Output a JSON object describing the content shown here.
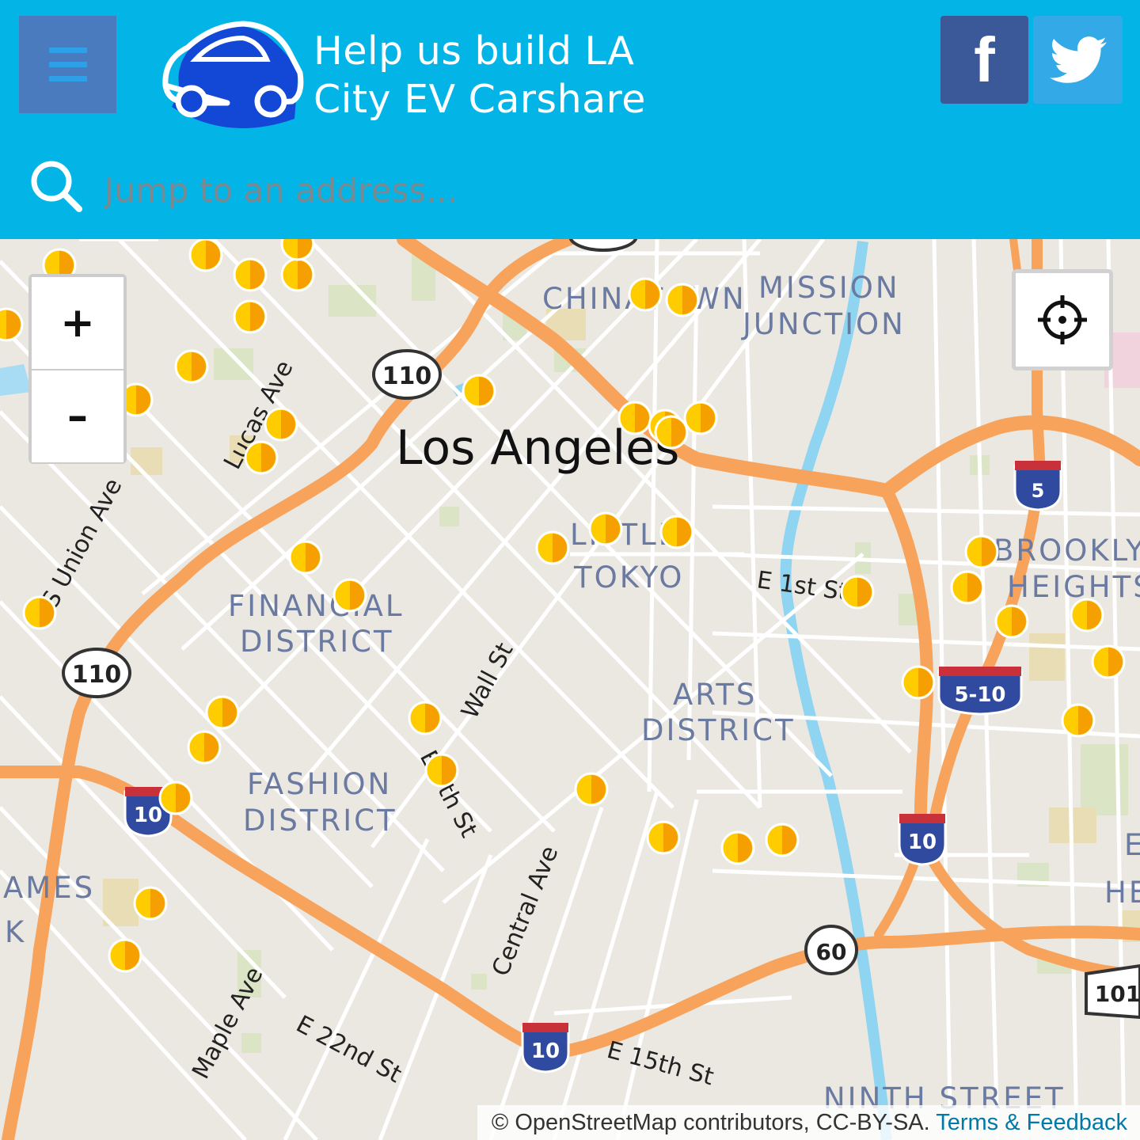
{
  "header": {
    "title_line1": "Help us build LA",
    "title_line2": "City EV Carshare",
    "menu_icon": "hamburger-menu-icon",
    "logo_icon": "car-logo-icon",
    "bg_color": "#03b5e6"
  },
  "social": {
    "facebook_glyph": "f",
    "facebook_color": "#3b5998",
    "twitter_icon": "twitter-bird-icon",
    "twitter_color": "#33a9e8"
  },
  "search": {
    "placeholder": "Jump to an address...",
    "value": ""
  },
  "map": {
    "city_label": "Los Angeles",
    "district_labels": [
      "CHINATOWN",
      "MISSION",
      "JUNCTION",
      "LITTLE",
      "TOKYO",
      "FINANCIAL",
      "DISTRICT",
      "ARTS",
      "DISTRICT",
      "FASHION",
      "DISTRICT",
      "BROOKLYN",
      "HEIGHTS",
      "NINTH STREET",
      "AMES",
      "K",
      "E",
      "HE"
    ],
    "street_labels": [
      "E 1st St",
      "Lucas Ave",
      "S Union Ave",
      "Wall St",
      "E 7th St",
      "Central Ave",
      "Maple Ave",
      "E 22nd St",
      "E 15th St"
    ],
    "highway_shields": [
      "110",
      "110",
      "5",
      "5-10",
      "10",
      "10",
      "10",
      "60",
      "101"
    ],
    "marker_color": "#ffcc00",
    "marker_accent": "#f5a000",
    "road_color": "#f7a35c"
  },
  "controls": {
    "zoom_in": "+",
    "zoom_out": "–",
    "locate_icon": "crosshair-locate-icon"
  },
  "attribution": {
    "text": "© OpenStreetMap contributors, CC-BY-SA. ",
    "link": "Terms & Feedback"
  }
}
